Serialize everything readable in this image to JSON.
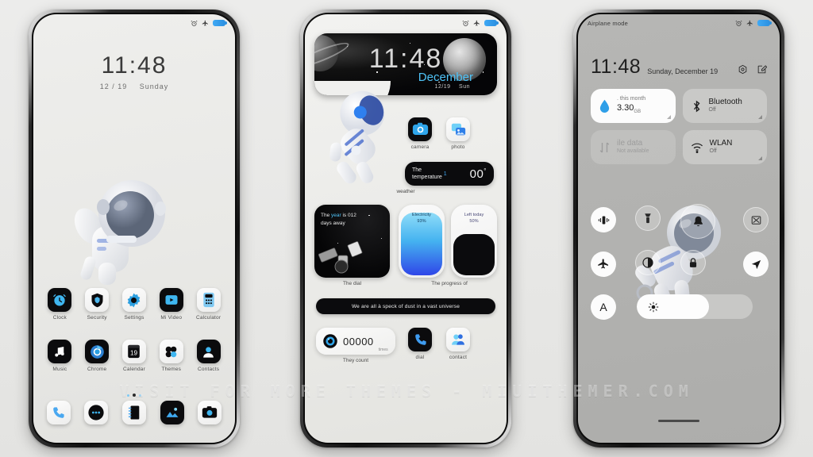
{
  "meta": {
    "watermark": "VISIT FOR MORE THEMES - MIUITHEMER.COM"
  },
  "phone1": {
    "statusbar": {
      "alarm_icon": "alarm-icon",
      "airplane_icon": "airplane-icon",
      "battery_icon": "battery-icon"
    },
    "clock": {
      "time": "11:48",
      "date": "12 / 19",
      "weekday": "Sunday"
    },
    "apps_row1": [
      {
        "label": "Clock",
        "icon": "clock-icon"
      },
      {
        "label": "Security",
        "icon": "shield-icon"
      },
      {
        "label": "Settings",
        "icon": "gear-icon"
      },
      {
        "label": "Mi Video",
        "icon": "video-icon"
      },
      {
        "label": "Calculator",
        "icon": "calculator-icon"
      }
    ],
    "apps_row2": [
      {
        "label": "Music",
        "icon": "music-note-icon"
      },
      {
        "label": "Chrome",
        "icon": "chrome-icon"
      },
      {
        "label": "Calendar",
        "icon": "calendar-icon",
        "day": "19"
      },
      {
        "label": "Themes",
        "icon": "themes-icon"
      },
      {
        "label": "Contacts",
        "icon": "contact-icon"
      }
    ],
    "dock": [
      {
        "label": "Phone",
        "icon": "phone-icon"
      },
      {
        "label": "Messages",
        "icon": "message-icon"
      },
      {
        "label": "Notes",
        "icon": "notes-icon"
      },
      {
        "label": "Gallery",
        "icon": "gallery-icon"
      },
      {
        "label": "Camera",
        "icon": "camera-icon"
      }
    ],
    "page_dots": 3,
    "active_dot": 2
  },
  "phone2": {
    "clock_widget": {
      "time": "11:48",
      "month": "December",
      "date": "12/19",
      "weekday": "Sun"
    },
    "apps_top": [
      {
        "label": "camera",
        "icon": "camera-icon"
      },
      {
        "label": "photo",
        "icon": "photo-icon"
      }
    ],
    "weather_widget": {
      "line1": "The",
      "line2": "temperature",
      "badge": "1",
      "value": "00",
      "unit": "°",
      "caption": "weather"
    },
    "dial_widget": {
      "text_a": "The ",
      "text_hl": "year",
      "text_b": " is  012",
      "text_c": "days away",
      "caption": "The dial"
    },
    "progress_widget": {
      "caption": "The progress of",
      "bars": [
        {
          "label": "Electricity",
          "value": "93%",
          "percent": 86
        },
        {
          "label": "Left today",
          "value": "50%",
          "percent": 56
        }
      ]
    },
    "quote": "We are all à speck of dust in a vast universe",
    "count_widget": {
      "number": "00000",
      "unit": "times",
      "caption": "They count",
      "icon": "ring-icon"
    },
    "apps_bottom": [
      {
        "label": "dial",
        "icon": "dial-icon"
      },
      {
        "label": "contact",
        "icon": "contacts-icon"
      }
    ]
  },
  "phone3": {
    "statusbar": {
      "left_text": "Airplane mode",
      "alarm_icon": "alarm-icon",
      "airplane_icon": "airplane-icon",
      "battery_icon": "battery-icon"
    },
    "header": {
      "time": "11:48",
      "date": "Sunday, December 19",
      "settings_icon": "gear-icon",
      "edit_icon": "edit-icon"
    },
    "tiles": [
      {
        "name": "data-usage",
        "state": "on",
        "top": ". this month",
        "value": "3.30",
        "unit": "GB",
        "icon": "water-drop-icon"
      },
      {
        "name": "bluetooth",
        "state": "off",
        "title": "Bluetooth",
        "sub": "Off",
        "icon": "bluetooth-icon"
      },
      {
        "name": "mobile-data",
        "state": "disabled",
        "title": "ile data",
        "sub": "Not available",
        "icon": "data-arrows-icon"
      },
      {
        "name": "wlan",
        "state": "off",
        "title": "WLAN",
        "sub": "Off",
        "icon": "wifi-icon"
      }
    ],
    "toggles": [
      {
        "name": "vibrate",
        "icon": "vibrate-icon",
        "style": "solid"
      },
      {
        "name": "flashlight",
        "icon": "flashlight-icon",
        "style": "ghost"
      },
      {
        "name": "ringer",
        "icon": "bell-icon",
        "style": "ghost"
      },
      {
        "name": "screenshot",
        "icon": "screenshot-icon",
        "style": "ghost"
      },
      {
        "name": "airplane-mode",
        "icon": "airplane-icon",
        "style": "solid"
      },
      {
        "name": "dark-mode",
        "icon": "contrast-icon",
        "style": "ghost"
      },
      {
        "name": "lock",
        "icon": "lock-icon",
        "style": "ghost"
      },
      {
        "name": "location",
        "icon": "location-icon",
        "style": "solid"
      },
      {
        "name": "auto-rotate",
        "icon": "letter-a-icon",
        "style": "solid",
        "letter": "A"
      }
    ],
    "brightness": {
      "icon": "sun-icon",
      "percent": 62
    }
  }
}
